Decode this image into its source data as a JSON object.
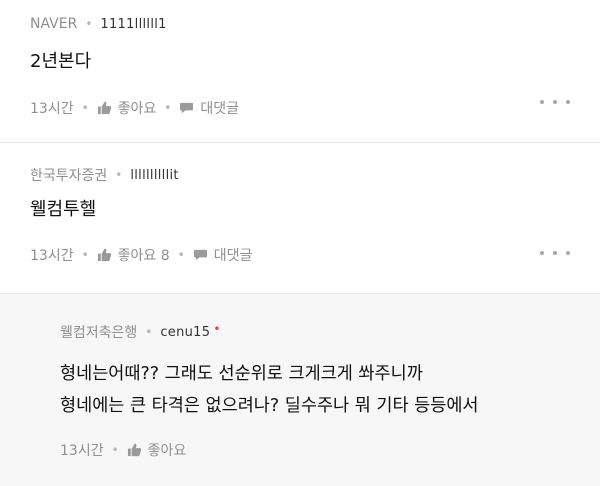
{
  "comments": [
    {
      "source": "NAVER",
      "user": "1111llllll1",
      "text": "2년본다",
      "time": "13시간",
      "like_label": "좋아요",
      "reply_label": "대댓글"
    },
    {
      "source": "한국투자증권",
      "user": "llllllllllit",
      "text": "웰컴투헬",
      "time": "13시간",
      "like_label": "좋아요 8",
      "reply_label": "대댓글"
    }
  ],
  "reply": {
    "source": "웰컴저축은행",
    "user": "cenu15",
    "author_mark": "•",
    "line1": "형네는어때?? 그래도 선순위로 크게크게 쏴주니까",
    "line2": "형네에는 큰 타격은 없으려나? 딜수주나 뭐 기타 등등에서",
    "time": "13시간",
    "like_label": "좋아요"
  },
  "separator": "•",
  "icons": {
    "like": "thumbs-up-icon",
    "reply": "speech-bubble-icon",
    "more": "more-dots-icon"
  },
  "colors": {
    "meta_gray": "#8f8f8f",
    "reply_background": "#f7f7f7",
    "author_dot": "#e8443a"
  }
}
